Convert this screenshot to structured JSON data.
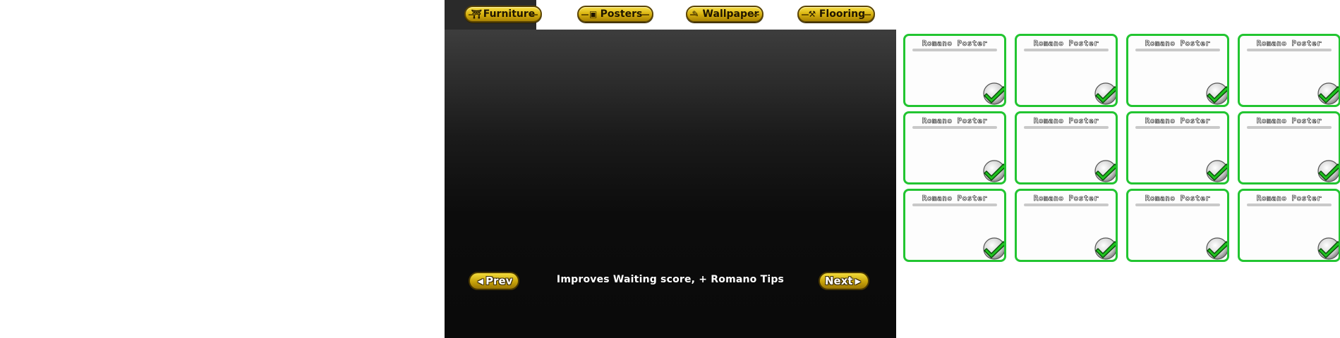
{
  "tabs": [
    {
      "label": "Furniture",
      "icon": "chair-icon"
    },
    {
      "label": "Posters",
      "icon": "poster-icon"
    },
    {
      "label": "Wallpaper",
      "icon": "brush-icon"
    },
    {
      "label": "Flooring",
      "icon": "trowel-icon"
    }
  ],
  "nav": {
    "prev_label": "Prev",
    "next_label": "Next"
  },
  "caption": "Improves Waiting score, + Romano Tips",
  "cards": [
    {
      "title": "Romano Poster",
      "checked": true
    },
    {
      "title": "Romano Poster",
      "checked": true
    },
    {
      "title": "Romano Poster",
      "checked": true
    },
    {
      "title": "Romano Poster",
      "checked": true
    },
    {
      "title": "Romano Poster",
      "checked": true
    },
    {
      "title": "Romano Poster",
      "checked": true
    },
    {
      "title": "Romano Poster",
      "checked": true
    },
    {
      "title": "Romano Poster",
      "checked": true
    },
    {
      "title": "Romano Poster",
      "checked": true
    },
    {
      "title": "Romano Poster",
      "checked": true
    },
    {
      "title": "Romano Poster",
      "checked": true
    },
    {
      "title": "Romano Poster",
      "checked": true
    }
  ],
  "colors": {
    "accent_yellow": "#d8b20e",
    "card_border": "#22c531",
    "check_green": "#1fc21f",
    "panel_dark": "#0b0b0b"
  }
}
